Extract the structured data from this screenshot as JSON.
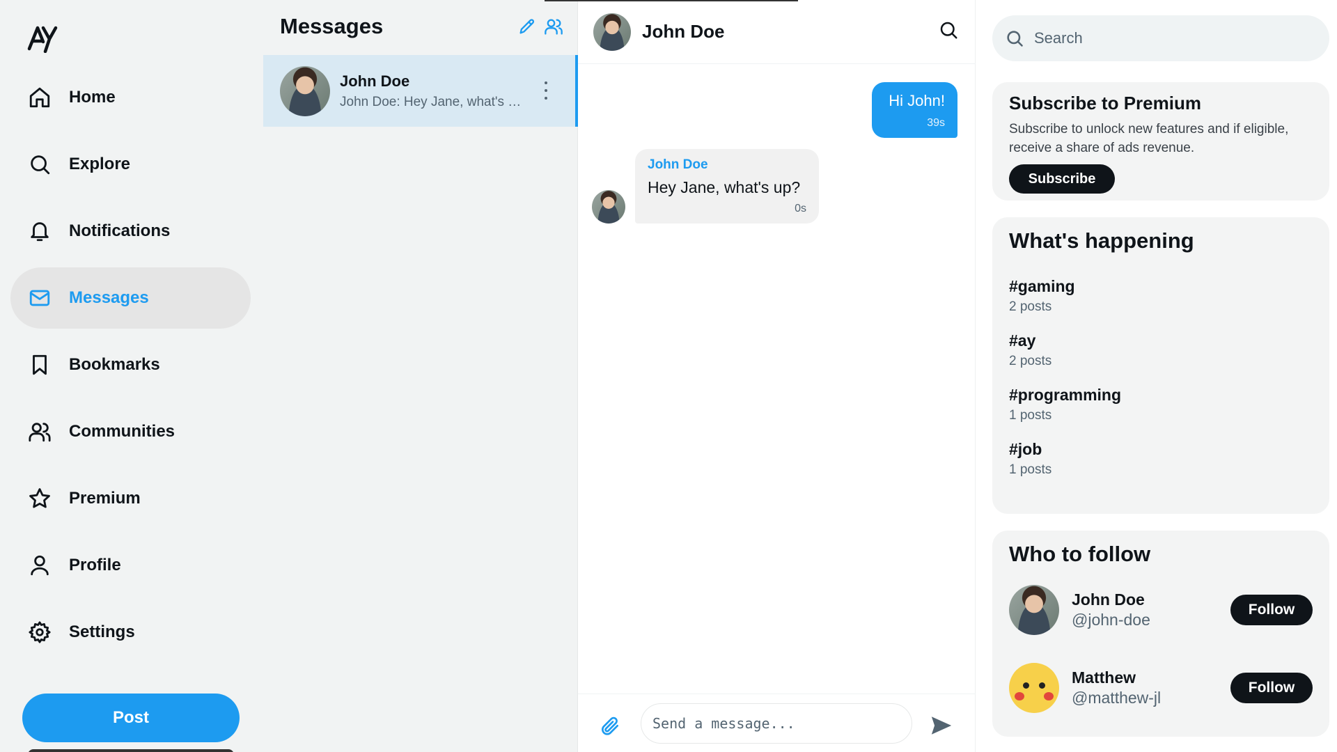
{
  "nav": {
    "logo": "AY",
    "items": [
      {
        "label": "Home",
        "icon": "home-icon"
      },
      {
        "label": "Explore",
        "icon": "search-icon"
      },
      {
        "label": "Notifications",
        "icon": "bell-icon"
      },
      {
        "label": "Messages",
        "icon": "mail-icon",
        "active": true
      },
      {
        "label": "Bookmarks",
        "icon": "bookmark-icon"
      },
      {
        "label": "Communities",
        "icon": "users-icon"
      },
      {
        "label": "Premium",
        "icon": "star-icon"
      },
      {
        "label": "Profile",
        "icon": "user-icon"
      },
      {
        "label": "Settings",
        "icon": "gear-icon"
      }
    ],
    "post_label": "Post"
  },
  "messages": {
    "title": "Messages",
    "conversations": [
      {
        "name": "John Doe",
        "preview": "John Doe: Hey Jane, what's up?"
      }
    ]
  },
  "chat": {
    "name": "John Doe",
    "outgoing": {
      "text": "Hi John!",
      "time": "39s"
    },
    "incoming": {
      "sender": "John Doe",
      "text": "Hey Jane, what's up?",
      "time": "0s"
    },
    "input_placeholder": "Send a message..."
  },
  "sidebar": {
    "search_placeholder": "Search",
    "premium": {
      "title": "Subscribe to Premium",
      "text": "Subscribe to unlock new features and if eligible, receive a share of ads revenue.",
      "button": "Subscribe"
    },
    "trends": {
      "title": "What's happening",
      "items": [
        {
          "tag": "#gaming",
          "count": "2 posts"
        },
        {
          "tag": "#ay",
          "count": "2 posts"
        },
        {
          "tag": "#programming",
          "count": "1 posts"
        },
        {
          "tag": "#job",
          "count": "1 posts"
        }
      ]
    },
    "follow": {
      "title": "Who to follow",
      "users": [
        {
          "name": "John Doe",
          "handle": "@john-doe",
          "button": "Follow"
        },
        {
          "name": "Matthew",
          "handle": "@matthew-jl",
          "button": "Follow"
        }
      ]
    }
  },
  "colors": {
    "accent": "#1d9bf0",
    "dark": "#0f1419",
    "panel": "#f1f3f3",
    "active_item": "#e5e5e5"
  }
}
